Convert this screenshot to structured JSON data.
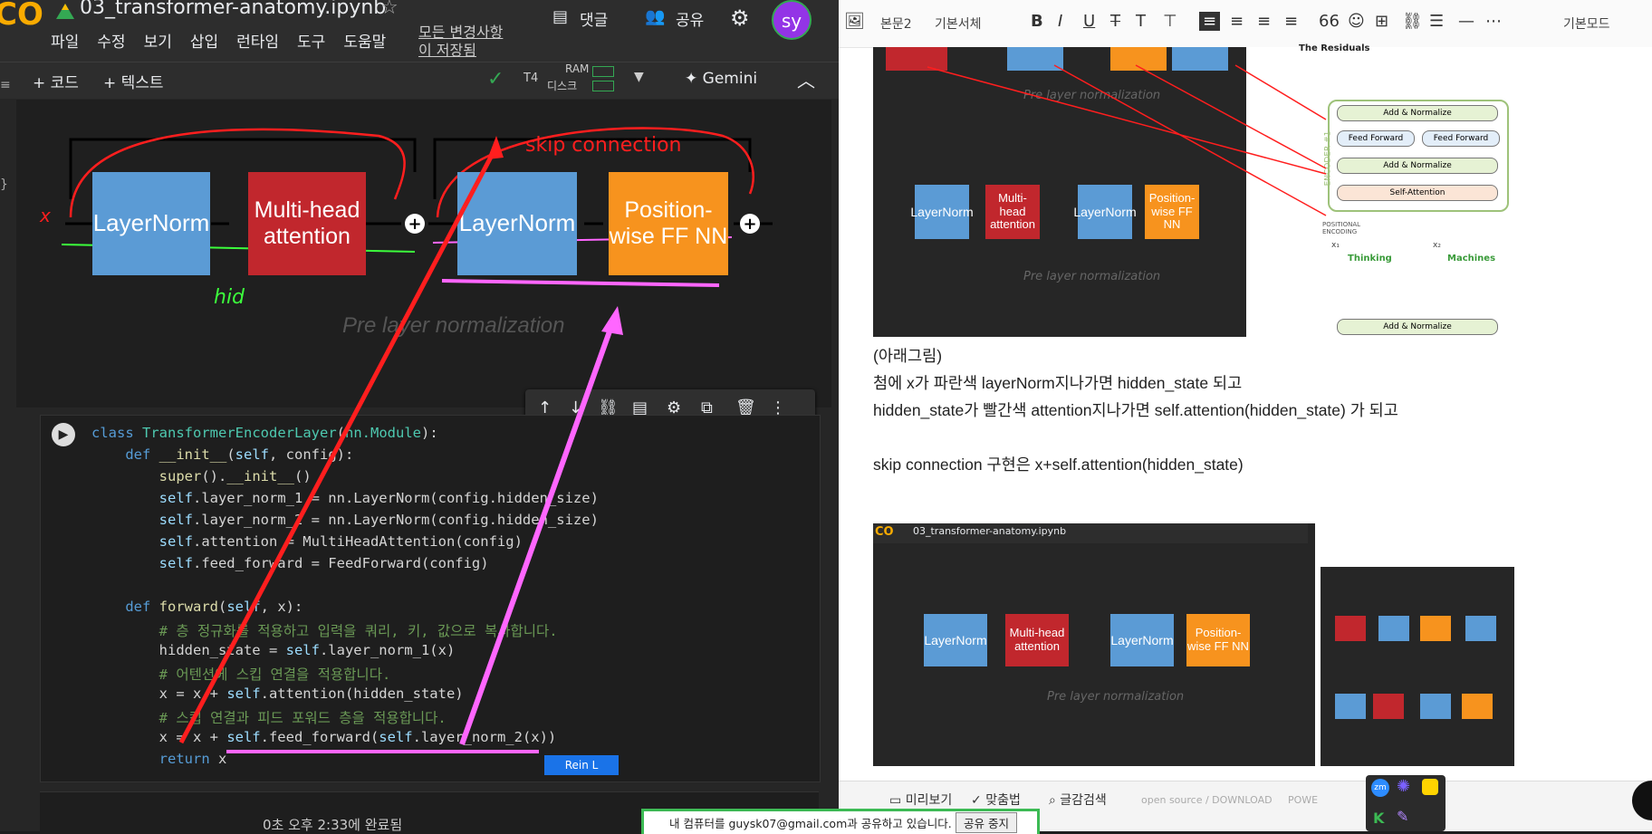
{
  "colab": {
    "logo": "CO",
    "title": "03_transformer-anatomy.ipynb",
    "menu": [
      "파일",
      "수정",
      "보기",
      "삽입",
      "런타임",
      "도구",
      "도움말"
    ],
    "save_status": "모든 변경사항이 저장됨",
    "comment_label": "댓글",
    "share_label": "공유",
    "avatar": "sy",
    "add_code": "+ 코드",
    "add_text": "+ 텍스트",
    "runtime": "T4",
    "ram": "RAM",
    "disk": "디스크",
    "gemini": "Gemini",
    "status_bar": "0초   오후 2:33에 완료됨"
  },
  "diagram": {
    "layernorm1": "LayerNorm",
    "mha": "Multi-head attention",
    "layernorm2": "LayerNorm",
    "ff": "Position-wise FF NN",
    "caption": "Pre layer normalization",
    "annot_skip": "skip connection",
    "annot_hid": "hid",
    "annot_x": "x"
  },
  "code": {
    "lines": [
      "class TransformerEncoderLayer(nn.Module):",
      "    def __init__(self, config):",
      "        super().__init__()",
      "        self.layer_norm_1 = nn.LayerNorm(config.hidden_size)",
      "        self.layer_norm_2 = nn.LayerNorm(config.hidden_size)",
      "        self.attention = MultiHeadAttention(config)",
      "        self.feed_forward = FeedForward(config)",
      "",
      "    def forward(self, x):",
      "        # 층 정규화를 적용하고 입력을 쿼리, 키, 값으로 복사합니다.",
      "        hidden_state = self.layer_norm_1(x)",
      "        # 어텐션에 스킵 연결을 적용합니다.",
      "        x = x + self.attention(hidden_state)",
      "        # 스킵 연결과 피드 포워드 층을 적용합니다.",
      "        x = x + self.feed_forward(self.layer_norm_2(x))",
      "        return x"
    ],
    "rein_label": "Rein L"
  },
  "editor": {
    "toolbar": {
      "style": "본문2",
      "font": "기본서체",
      "mode": "기본모드"
    },
    "para1": "(아래그림)",
    "para2": "첨에 x가  파란색 layerNorm지나가면 hidden_state 되고",
    "para3": "hidden_state가 빨간색 attention지나가면 self.attention(hidden_state) 가 되고",
    "para4": "skip connection 구현은  x+self.attention(hidden_state)",
    "shot1": {
      "ln": "LayerNorm",
      "mha": "Multi-head attention",
      "ff": "Position-wise FF NN",
      "caption1": "Pre layer normalization",
      "caption2": "Pre layer normalization",
      "residuals_title": "The Residuals",
      "add_norm": "Add & Normalize",
      "feed_forward": "Feed Forward",
      "self_attention": "Self-Attention",
      "encoder_label": "ENCODER #1",
      "pos_enc": "POSITIONAL ENCODING",
      "x1": "x₁",
      "x2": "x₂",
      "thinking": "Thinking",
      "machines": "Machines"
    },
    "bottom": {
      "preview": "미리보기",
      "spell": "맞춤법",
      "search": "글감검색",
      "open_source": "open source / DOWNLOAD",
      "power": "POWE"
    }
  },
  "share_banner": {
    "text": "내 컴퓨터를 guysk07@gmail.com과 공유하고 있습니다.",
    "stop": "공유 중지"
  },
  "colors": {
    "layernorm": "#5b9bd5",
    "attention": "#c1272d",
    "feedforward": "#f7931e",
    "annot_red": "#ff1e1e",
    "annot_pink": "#ff66ff",
    "annot_green": "#3cff3c"
  }
}
